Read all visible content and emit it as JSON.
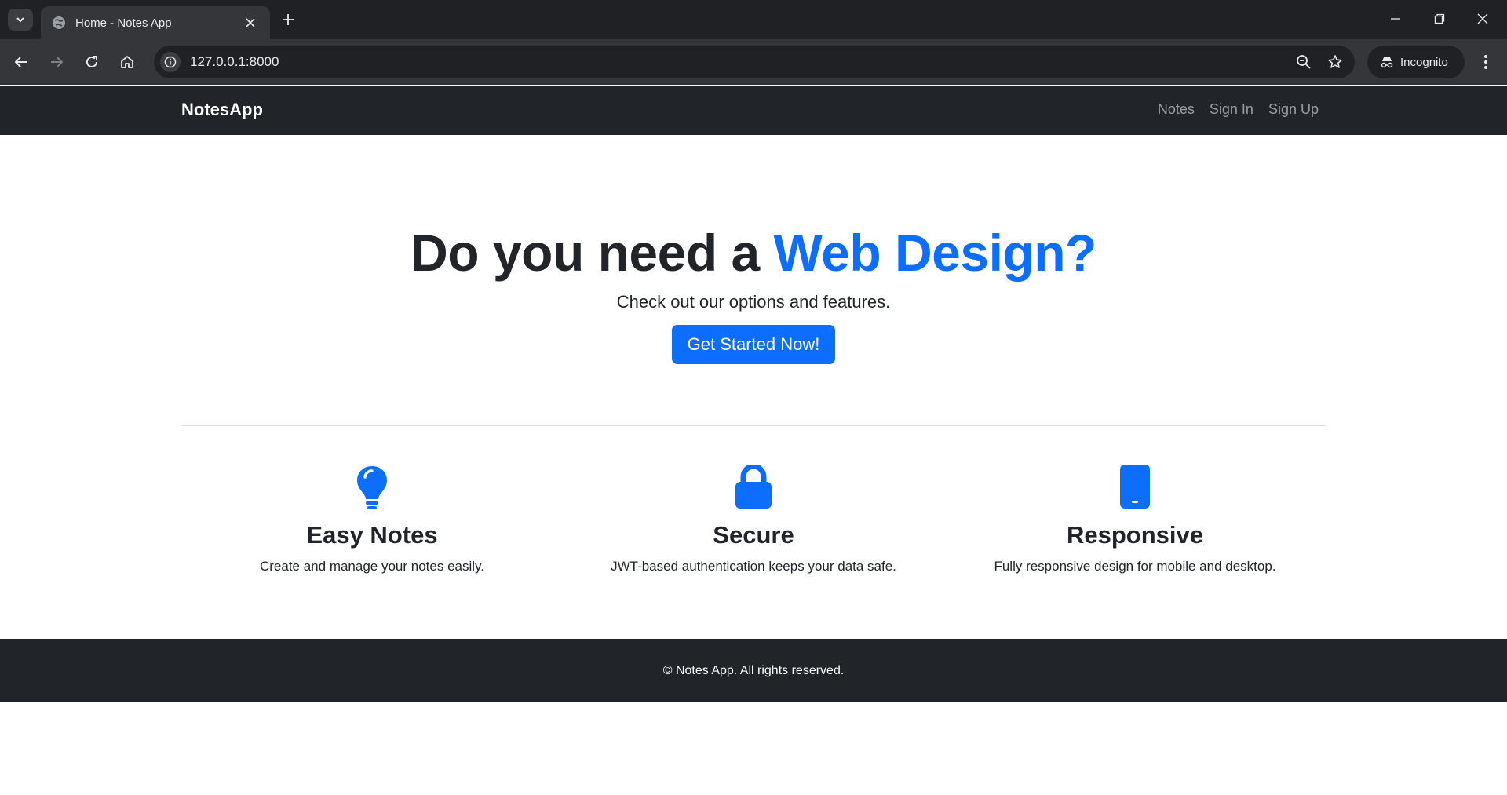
{
  "browser": {
    "tab_title": "Home - Notes App",
    "url": "127.0.0.1:8000",
    "incognito_label": "Incognito"
  },
  "nav": {
    "brand": "NotesApp",
    "links": [
      "Notes",
      "Sign In",
      "Sign Up"
    ]
  },
  "hero": {
    "title_prefix": "Do you need a ",
    "title_accent": "Web Design?",
    "subtitle": "Check out our options and features.",
    "cta_label": "Get Started Now!"
  },
  "features": [
    {
      "icon": "lightbulb-icon",
      "title": "Easy Notes",
      "text": "Create and manage your notes easily."
    },
    {
      "icon": "lock-icon",
      "title": "Secure",
      "text": "JWT-based authentication keeps your data safe."
    },
    {
      "icon": "phone-icon",
      "title": "Responsive",
      "text": "Fully responsive design for mobile and desktop."
    }
  ],
  "footer": {
    "text": "© Notes App. All rights reserved."
  },
  "colors": {
    "accent": "#0d6efd",
    "dark": "#212529",
    "chrome_bg": "#202124"
  }
}
